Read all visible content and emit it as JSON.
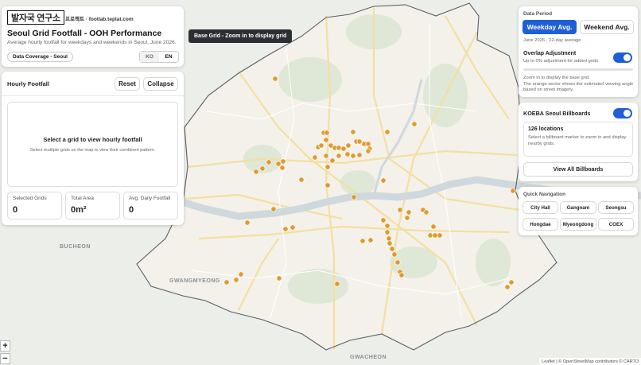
{
  "app": {
    "logo_text": "발자국 연구소",
    "site_text": "프로젝트 · footlab.teplat.com",
    "title": "Seoul Grid Footfall - OOH Performance",
    "subtitle": "Average hourly footfall for weekdays and weekends in Seoul, June 2026.",
    "coverage_label": "Data Coverage - Seoul",
    "lang_ko": "KO",
    "lang_en": "EN"
  },
  "hourly": {
    "title": "Hourly Footfall",
    "reset_label": "Reset",
    "collapse_label": "Collapse",
    "empty_title": "Select a grid to view hourly footfall",
    "empty_sub": "Select multiple grids on the map to view their combined pattern.",
    "stats": [
      {
        "label": "Selected Grids",
        "value": "0"
      },
      {
        "label": "Total Area",
        "value": "0m²"
      },
      {
        "label": "Avg. Daily Footfall",
        "value": "0"
      }
    ]
  },
  "tooltip": {
    "text": "Base Grid - Zoom in to display grid"
  },
  "data_period": {
    "title": "Data Period",
    "weekday_label": "Weekday Avg.",
    "weekend_label": "Weekend Avg.",
    "note": "June 2026 · 22-day average",
    "overlap_title": "Overlap Adjustment",
    "overlap_sub": "Up to 0% adjustment for added grids",
    "zoom_note": "Zoom in to display the base grid.",
    "sector_note": "The orange sector shows the estimated viewing angle based on street imagery."
  },
  "billboards": {
    "title": "KOEBA Seoul Billboards",
    "count": "126 locations",
    "hint": "Select a billboard marker to zoom in and display nearby grids.",
    "view_all_label": "View All Billboards"
  },
  "quick_nav": {
    "title": "Quick Navigation",
    "items": [
      "City Hall",
      "Gangnam",
      "Seongsu",
      "Hongdae",
      "Myeongdong",
      "COEX"
    ]
  },
  "map": {
    "districts": [
      "BUCHEON",
      "GWANGMYEONG",
      "GWACHEON"
    ],
    "zoom_in": "+",
    "zoom_out": "−",
    "attribution": "Leaflet | © OpenStreetMap contributors © CARTO",
    "colors": {
      "marker": "#e09a2e",
      "boundary": "#5b5f66",
      "river": "#cfd8dc",
      "road": "#f4dfa0"
    }
  }
}
